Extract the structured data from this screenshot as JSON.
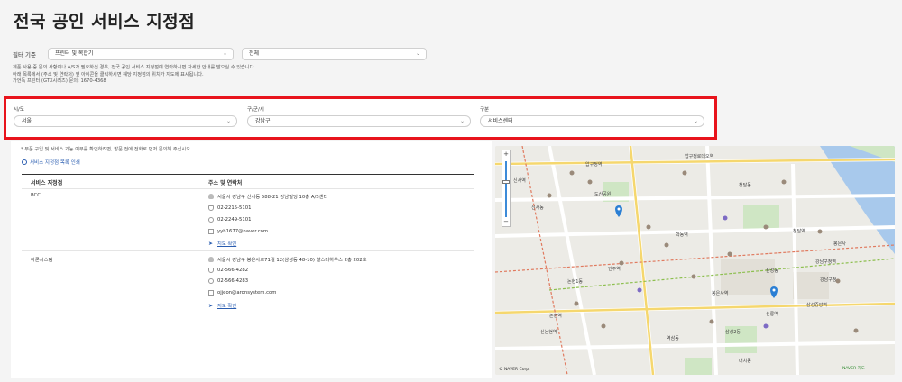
{
  "page": {
    "title": "전국 공인 서비스 지정점"
  },
  "filter": {
    "label": "필터 기준",
    "category_value": "프린터 및 복합기",
    "product_value": "전체"
  },
  "notes": {
    "line1": "제품 사용 중 문의 사항이나 A/S가 필요하신 경우, 전국 공인 서비스 지정점에 연락하시면 자세한 안내를 받으실 수 있습니다.",
    "line2": "아래 목록에서 (주소 및 연락처) 옆 아이콘을 클릭하시면 해당 지정점의 위치가 지도에 표시됩니다.",
    "line3": "가언독 프린터 (GTX시리즈) 문의: 1670-4368"
  },
  "region": {
    "sido_label": "시/도",
    "sido_value": "서울",
    "gugun_label": "구/군/시",
    "gugun_value": "강남구",
    "type_label": "구분",
    "type_value": "서비스센터"
  },
  "list": {
    "notice": "* 부품 구입 및 서비스 가능 여부를 확인하려면, 방문 전에 전화로 먼저 문의해 주십시오.",
    "print_label": "서비스 지정점 목록 인쇄",
    "col_name": "서비스 지정점",
    "col_contact": "주소 및 연락처",
    "map_link_label": "지도 확인",
    "rows": [
      {
        "name": "BCC",
        "address": "서울시 강남구 신사동 588-21 강남빌딩 10층 A/S센터",
        "phone": "02-2215-5101",
        "fax": "02-2249-5101",
        "email": "yyh1677@naver.com"
      },
      {
        "name": "아론시스템",
        "address": "서울시 강남구 봉은사로71길 12(삼성동 48-10) 알스터하우스 2층 202호",
        "phone": "02-566-4282",
        "fax": "02-566-4283",
        "email": "ojjeon@aronsystem.com"
      }
    ]
  },
  "map": {
    "credit": "© NAVER Corp.",
    "scale": "NAVER 지도",
    "road_color": "#ffffff",
    "park_color": "#cfe6c4",
    "water_color": "#a8c9ec",
    "marker_color": "#2b7fd4",
    "labels": [
      "압구정역",
      "압구정로데오역",
      "청담역",
      "강남구청역",
      "신사역",
      "논현역",
      "학동역",
      "선릉역",
      "삼성중앙역",
      "봉은사역",
      "신논현역",
      "언주역",
      "청담동",
      "삼성동",
      "논현1동",
      "대치동",
      "역삼동",
      "강남구청",
      "삼성2동",
      "신사동",
      "도산공원",
      "봉은사"
    ]
  }
}
